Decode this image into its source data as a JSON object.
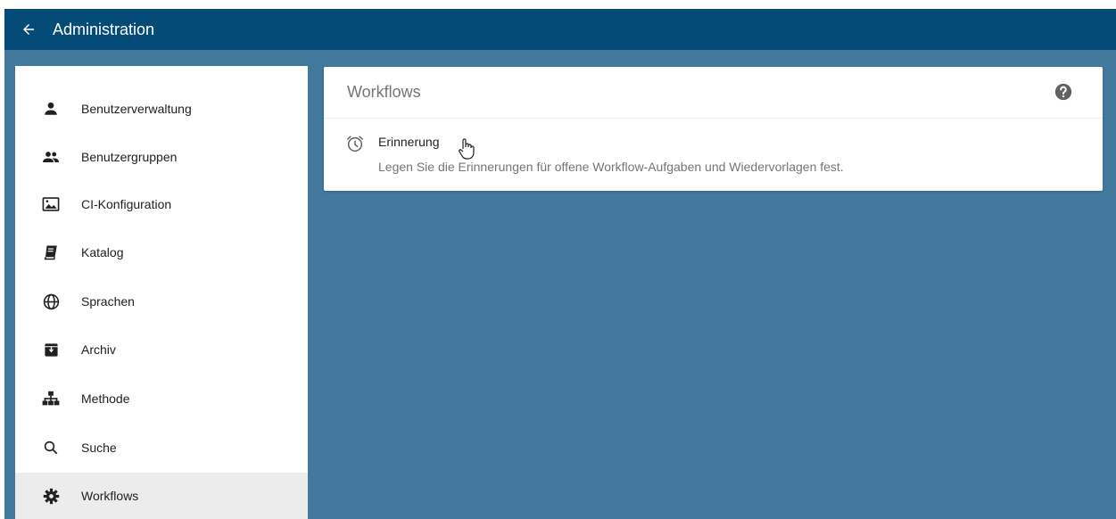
{
  "header": {
    "back_icon": "arrow-left-icon",
    "title": "Administration"
  },
  "sidebar": {
    "items": [
      {
        "label": "Benutzerverwaltung",
        "icon": "person-icon"
      },
      {
        "label": "Benutzergruppen",
        "icon": "people-icon"
      },
      {
        "label": "CI-Konfiguration",
        "icon": "image-icon"
      },
      {
        "label": "Katalog",
        "icon": "book-icon"
      },
      {
        "label": "Sprachen",
        "icon": "globe-icon"
      },
      {
        "label": "Archiv",
        "icon": "archive-icon"
      },
      {
        "label": "Methode",
        "icon": "sitemap-icon"
      },
      {
        "label": "Suche",
        "icon": "search-icon"
      },
      {
        "label": "Workflows",
        "icon": "gear-icon",
        "active": true
      }
    ]
  },
  "main": {
    "card": {
      "title": "Workflows",
      "help_icon": "help-circle-icon",
      "entries": [
        {
          "title": "Erinnerung",
          "description": "Legen Sie die Erinnerungen für offene Workflow-Aufgaben und Wiedervorlagen fest.",
          "icon": "alarm-clock-icon"
        }
      ]
    }
  },
  "colors": {
    "header": "#044b78",
    "background": "#43799c",
    "sidebar_active": "#ececec"
  }
}
